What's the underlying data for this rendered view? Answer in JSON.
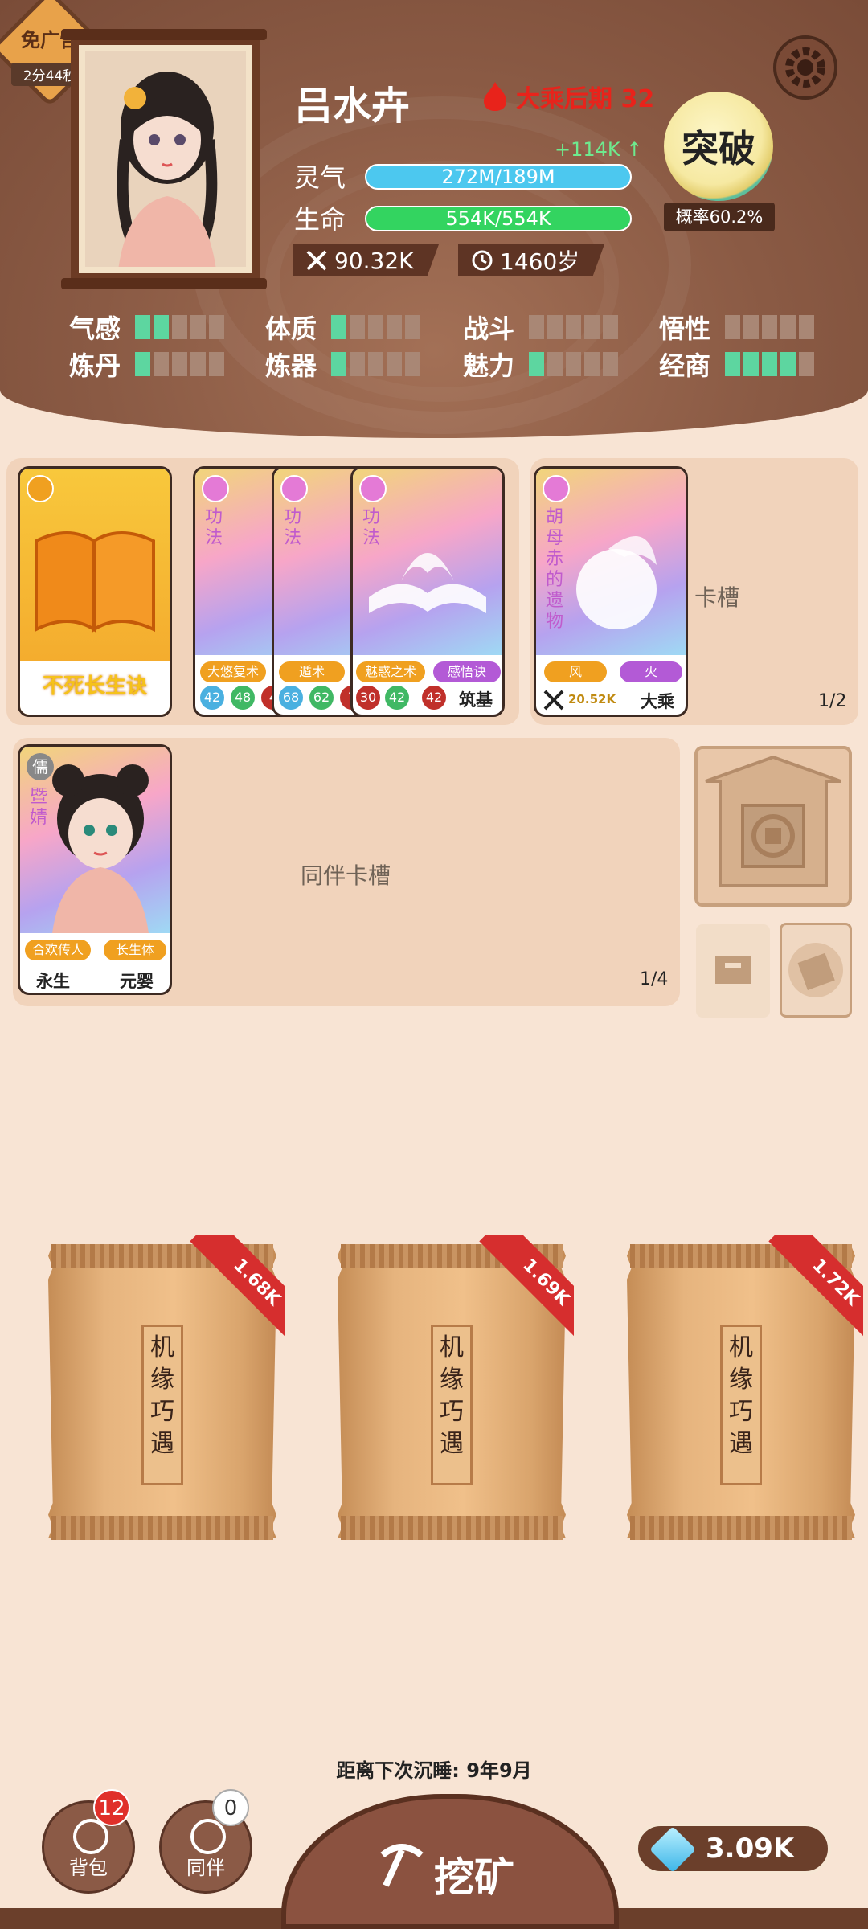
{
  "header": {
    "noad_label": "免广告",
    "noad_timer": "2分44秒",
    "name": "吕水卉",
    "realm": "大乘后期 32",
    "lingqi_label": "灵气",
    "lingqi_value": "272M/189M",
    "lingqi_gain": "+114K ↑",
    "life_label": "生命",
    "life_value": "554K/554K",
    "life_fraction": 1.0,
    "power": "90.32K",
    "age": "1460岁",
    "breakthrough_label": "突破",
    "breakthrough_chance": "概率60.2%"
  },
  "attributes": [
    {
      "name": "气感",
      "level": 2
    },
    {
      "name": "体质",
      "level": 1
    },
    {
      "name": "战斗",
      "level": 0
    },
    {
      "name": "悟性",
      "level": 0
    },
    {
      "name": "炼丹",
      "level": 1
    },
    {
      "name": "炼器",
      "level": 1
    },
    {
      "name": "魅力",
      "level": 1
    },
    {
      "name": "经商",
      "level": 4
    }
  ],
  "cards": {
    "main": {
      "title": "不死长生诀"
    },
    "technique_cards": [
      {
        "type": "功法",
        "tag": "大悠复术",
        "n1": "42",
        "n2": "48",
        "n3": "4"
      },
      {
        "type": "功法",
        "tag": "遁术",
        "n1": "68",
        "n2": "62",
        "n3": "7"
      },
      {
        "type": "功法",
        "tag1": "魅惑之术",
        "tag2": "感悟诀",
        "n1": "30",
        "n2": "42",
        "n3": "42",
        "realm": "筑基"
      }
    ],
    "relic": {
      "title": "胡母赤的遗物",
      "tag1": "风",
      "tag2": "火",
      "power": "20.52K",
      "realm": "大乘"
    },
    "relic_slot_label": "卡槽",
    "relic_slot_count": "1/2",
    "companion": {
      "type": "儒",
      "name": "暨婧",
      "tag1": "合欢传人",
      "tag2": "长生体",
      "bottom1": "永生",
      "bottom2": "元婴"
    },
    "companion_slot_label": "同伴卡槽",
    "companion_slot_count": "1/4"
  },
  "packs": [
    {
      "title": "机缘巧遇",
      "price": "1.68K"
    },
    {
      "title": "机缘巧遇",
      "price": "1.69K"
    },
    {
      "title": "机缘巧遇",
      "price": "1.72K"
    }
  ],
  "footer": {
    "sleep_text": "距离下次沉睡: 9年9月",
    "bag_label": "背包",
    "bag_badge": "12",
    "companion_label": "同伴",
    "companion_badge": "0",
    "mine_label": "挖矿",
    "gems": "3.09K"
  },
  "colors": {
    "lingqi_bar": "#4cc8ef",
    "life_bar": "#33d460",
    "pip_on": "#5dd6a0",
    "realm_red": "#e8231b"
  }
}
